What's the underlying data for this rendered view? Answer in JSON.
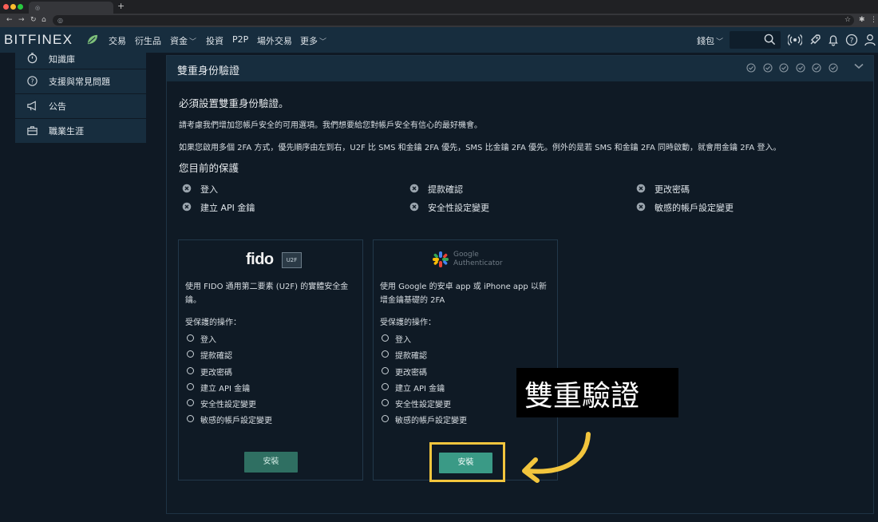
{
  "browser": {
    "tab_favicon": "◎",
    "new_tab": "+",
    "nav_icons": [
      "←",
      "→",
      "↻",
      "⌂"
    ]
  },
  "header": {
    "logo_text": "BITFINEX",
    "menu": [
      {
        "label": "交易",
        "chevron": false
      },
      {
        "label": "衍生品",
        "chevron": false
      },
      {
        "label": "資金",
        "chevron": true
      },
      {
        "label": "投資",
        "chevron": false
      },
      {
        "label": "P2P",
        "chevron": false
      },
      {
        "label": "場外交易",
        "chevron": false
      },
      {
        "label": "更多",
        "chevron": true
      }
    ],
    "wallet_label": "錢包",
    "icons": [
      "search-icon",
      "broadcast-icon",
      "rocket-icon",
      "bell-icon",
      "help-icon",
      "user-icon"
    ]
  },
  "sidebar": {
    "items": [
      {
        "label": "知識庫",
        "icon": "stopwatch-icon"
      },
      {
        "label": "支援與常見問題",
        "icon": "question-icon"
      },
      {
        "label": "公告",
        "icon": "megaphone-icon"
      },
      {
        "label": "職業生涯",
        "icon": "briefcase-icon"
      }
    ]
  },
  "panel": {
    "title": "雙重身份驗證",
    "heading_required": "必須設置雙重身份驗證。",
    "paragraph_1": "請考慮我們增加您帳戶安全的可用選項。我們想要給您對帳戶安全有信心的最好機會。",
    "paragraph_2": "如果您啟用多個 2FA 方式，優先順序由左到右，U2F 比 SMS 和金鑰 2FA 優先，SMS 比金鑰 2FA 優先。例外的是若 SMS 和金鑰 2FA 同時啟動，就會用金鑰 2FA 登入。",
    "heading_protection": "您目前的保護",
    "protections": [
      "登入",
      "提款確認",
      "更改密碼",
      "建立 API 金鑰",
      "安全性設定變更",
      "敏感的帳戶設定變更"
    ]
  },
  "cards": [
    {
      "logo": "fido",
      "logo_badge": "U2F",
      "description": "使用 FIDO 通用第二要素 (U2F) 的實體安全金鑰。",
      "ops_heading": "受保護的操作：",
      "ops": [
        "登入",
        "提款確認",
        "更改密碼",
        "建立 API 金鑰",
        "安全性設定變更",
        "敏感的帳戶設定變更"
      ],
      "button": "安裝"
    },
    {
      "logo_line1": "Google",
      "logo_line2": "Authenticator",
      "description": "使用 Google 的安卓 app 或 iPhone app 以新增金鑰基礎的 2FA",
      "ops_heading": "受保護的操作：",
      "ops": [
        "登入",
        "提款確認",
        "更改密碼",
        "建立 API 金鑰",
        "安全性設定變更",
        "敏感的帳戶設定變更"
      ],
      "button": "安裝"
    }
  ],
  "callout": {
    "text": "雙重驗證"
  },
  "colors": {
    "accent_highlight": "#f2c53d",
    "button_green": "#3a9a86",
    "header_bg": "#172d3e"
  }
}
